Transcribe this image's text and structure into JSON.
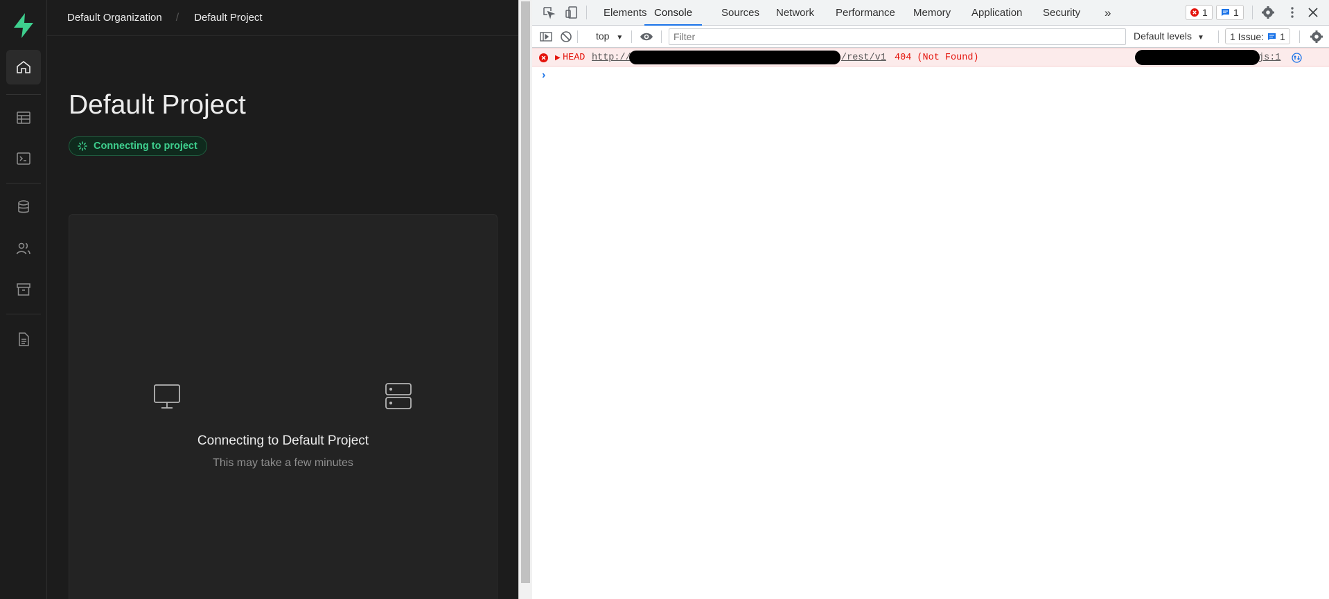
{
  "app": {
    "breadcrumb": {
      "org": "Default Organization",
      "separator": "/",
      "project": "Default Project"
    },
    "page_title": "Default Project",
    "status_badge": "Connecting to project",
    "card": {
      "title": "Connecting to Default Project",
      "subtitle": "This may take a few minutes"
    },
    "sidebar_icons": [
      "home-icon",
      "table-editor-icon",
      "sql-editor-icon",
      "database-icon",
      "authentication-icon",
      "storage-icon",
      "docs-icon"
    ],
    "accent_color": "#3ecf8e"
  },
  "devtools": {
    "tabs": [
      "Elements",
      "Console",
      "Sources",
      "Network",
      "Performance",
      "Memory",
      "Application",
      "Security"
    ],
    "active_tab": "Console",
    "more_tabs": "»",
    "error_count": "1",
    "message_count": "1",
    "toolbar": {
      "context": "top",
      "filter_placeholder": "Filter",
      "levels": "Default levels",
      "issues_label": "1 Issue:",
      "issues_count": "1"
    },
    "console": {
      "method": "HEAD",
      "url_prefix": "http://",
      "url_suffix": "/rest/v1",
      "status": "404 (Not Found)",
      "source": "js:1",
      "prompt": "›"
    },
    "error_color": "#e4140c"
  }
}
